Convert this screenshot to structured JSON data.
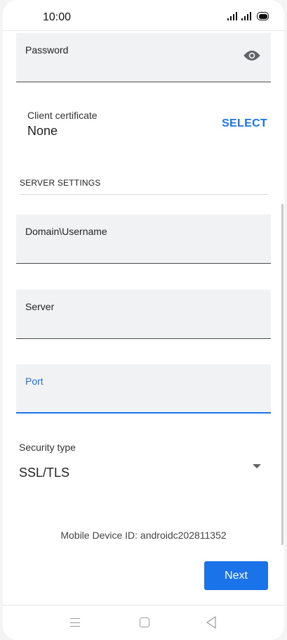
{
  "status_bar": {
    "time": "10:00"
  },
  "password_field": {
    "label": "Password"
  },
  "client_certificate": {
    "label": "Client certificate",
    "value": "None",
    "action": "SELECT"
  },
  "server_settings": {
    "title": "SERVER SETTINGS",
    "fields": [
      {
        "label": "Domain\\Username"
      },
      {
        "label": "Server"
      },
      {
        "label": "Port"
      }
    ]
  },
  "security_type": {
    "label": "Security type",
    "value": "SSL/TLS"
  },
  "device_id": "Mobile Device ID: androidc202811352",
  "next_button": "Next",
  "colors": {
    "accent": "#1a73e8",
    "field_bg": "#f1f2f4"
  }
}
